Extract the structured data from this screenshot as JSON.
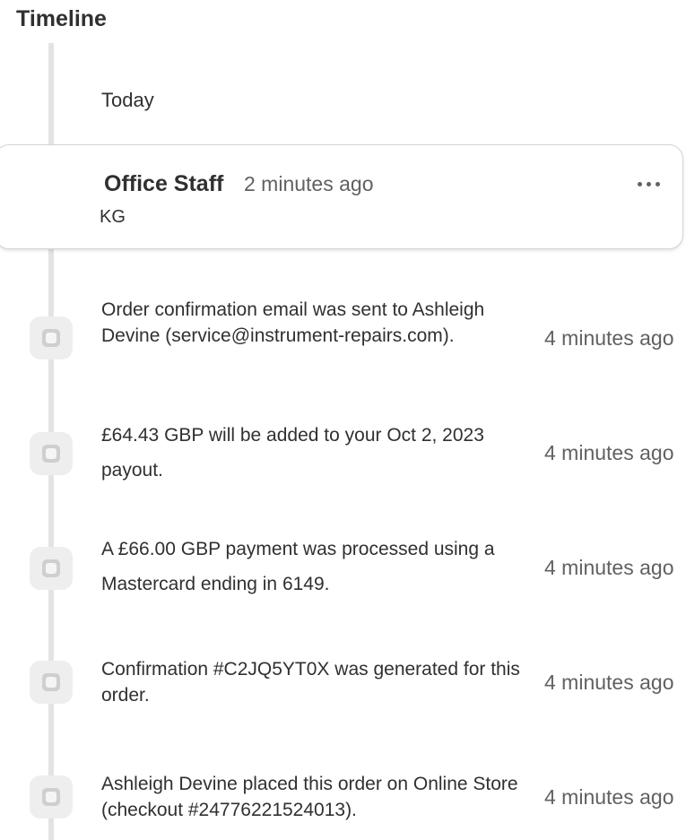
{
  "timeline": {
    "title": "Timeline",
    "date_label": "Today"
  },
  "comment": {
    "author": "Office Staff",
    "time": "2 minutes ago",
    "body": "KG",
    "more_icon": "ellipsis-horizontal-icon"
  },
  "events": [
    {
      "text": "Order confirmation email was sent to Ashleigh Devine (service@instrument-repairs.com).",
      "time": "4 minutes ago",
      "icon": "event-marker-icon"
    },
    {
      "text": "£64.43 GBP will be added to your Oct 2, 2023 payout.",
      "time": "4 minutes ago",
      "icon": "event-marker-icon"
    },
    {
      "text": "A £66.00 GBP payment was processed using a Mastercard ending in 6149.",
      "time": "4 minutes ago",
      "icon": "event-marker-icon"
    },
    {
      "text": "Confirmation #C2JQ5YT0X was generated for this order.",
      "time": "4 minutes ago",
      "icon": "event-marker-icon"
    },
    {
      "text": "Ashleigh Devine placed this order on Online Store (checkout #24776221524013).",
      "time": "4 minutes ago",
      "icon": "event-marker-icon"
    }
  ],
  "colors": {
    "text": "#303030",
    "muted": "#616161",
    "rail": "#e3e3e3",
    "border": "#d4d4d4"
  }
}
